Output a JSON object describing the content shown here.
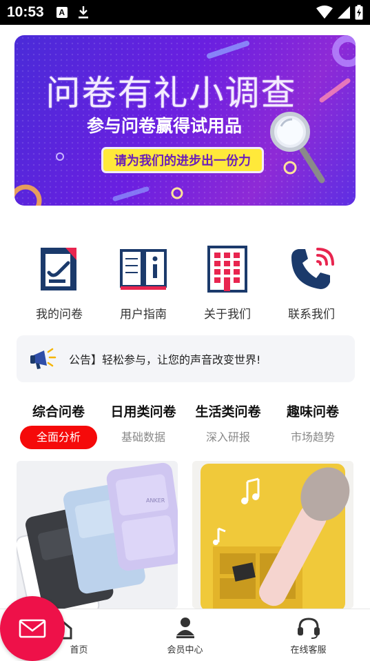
{
  "status_bar": {
    "time": "10:53",
    "notif_icon_letter": "A"
  },
  "banner": {
    "title": "问卷有礼小调查",
    "subtitle": "参与问卷赢得试用品",
    "pill": "请为我们的进步出一份力"
  },
  "quick_links": [
    {
      "label": "我的问卷",
      "icon": "document-edit-icon"
    },
    {
      "label": "用户指南",
      "icon": "book-info-icon"
    },
    {
      "label": "关于我们",
      "icon": "building-icon"
    },
    {
      "label": "联系我们",
      "icon": "phone-icon"
    }
  ],
  "notice": {
    "text": "公告】轻松参与，让您的声音改变世界!",
    "icon": "megaphone-icon"
  },
  "categories": [
    {
      "title": "综合问卷",
      "sub": "全面分析",
      "active": true
    },
    {
      "title": "日用类问卷",
      "sub": "基础数据",
      "active": false
    },
    {
      "title": "生活类问卷",
      "sub": "深入研报",
      "active": false
    },
    {
      "title": "趣味问卷",
      "sub": "市场趋势",
      "active": false
    }
  ],
  "products": [
    {
      "brand_text": "ANKER"
    },
    {
      "brand_text": ""
    }
  ],
  "tabbar": [
    {
      "label": "首页",
      "icon": "home-icon"
    },
    {
      "label": "会员中心",
      "icon": "user-icon"
    },
    {
      "label": "在线客服",
      "icon": "headset-icon"
    }
  ],
  "colors": {
    "accent": "#f50a0a",
    "fab": "#ee1149",
    "navy": "#1b3a6b"
  }
}
